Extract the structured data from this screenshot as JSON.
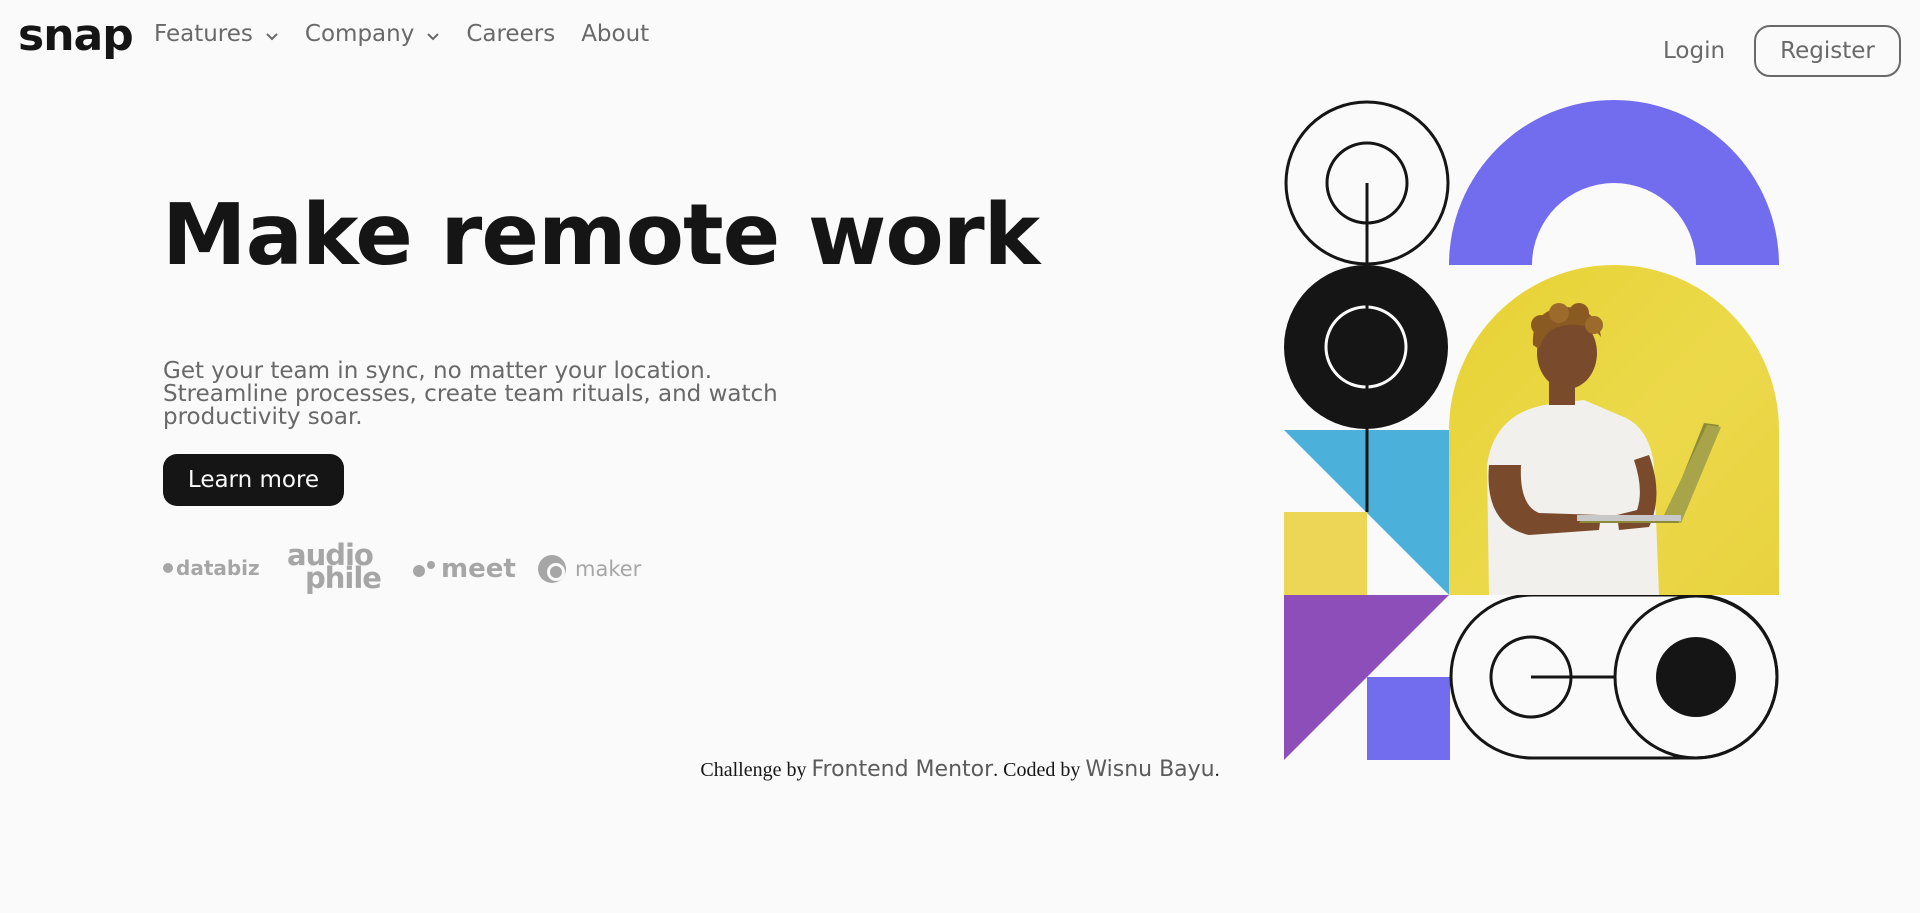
{
  "header": {
    "logo": "snap",
    "nav": [
      {
        "label": "Features",
        "has_dropdown": true
      },
      {
        "label": "Company",
        "has_dropdown": true
      },
      {
        "label": "Careers",
        "has_dropdown": false
      },
      {
        "label": "About",
        "has_dropdown": false
      }
    ],
    "login_label": "Login",
    "register_label": "Register"
  },
  "hero": {
    "title": "Make remote work",
    "description": "Get your team in sync, no matter your location. Streamline processes, create team rituals, and watch productivity soar.",
    "cta_label": "Learn more"
  },
  "clients": {
    "databiz": "databiz",
    "audiophile_line1": "audio",
    "audiophile_line2": "phile",
    "meet": "meet",
    "maker": "maker"
  },
  "attribution": {
    "prefix": "Challenge by",
    "challenge_link": "Frontend Mentor",
    "middle": ". Coded by",
    "author_link": "Wisnu Bayu",
    "suffix": "."
  },
  "colors": {
    "text_dark": "#151515",
    "text_gray": "#696969",
    "logo_gray": "#a6a6a6",
    "accent_purple": "#726cee",
    "accent_blue": "#4bb1da",
    "accent_yellow": "#edd556",
    "accent_violet": "#8d4eb9",
    "background": "#fafafa"
  },
  "icons": {
    "dropdown": "chevron-down-icon",
    "maker": "maker-logo-icon"
  }
}
